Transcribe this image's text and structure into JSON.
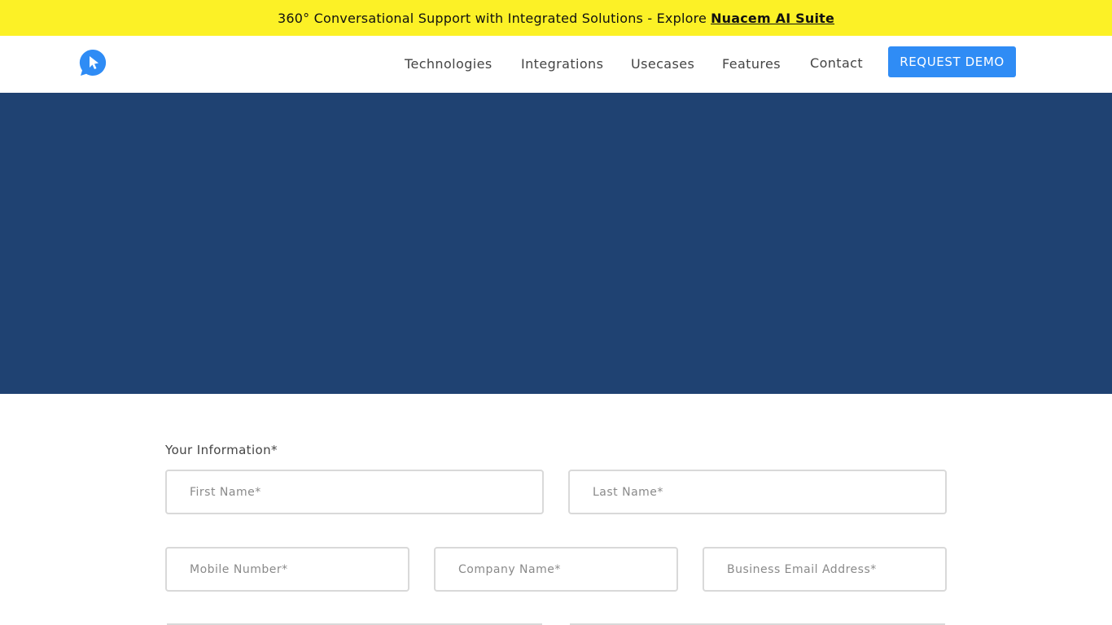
{
  "announcement": {
    "text": "360° Conversational Support with Integrated Solutions - Explore",
    "link": "Nuacem AI Suite"
  },
  "nav": {
    "logo_icon": "chat-bubble-logo-icon",
    "items": [
      {
        "label": "Technologies"
      },
      {
        "label": "Integrations"
      },
      {
        "label": "Usecases"
      },
      {
        "label": "Features"
      },
      {
        "label": "Contact"
      }
    ],
    "cta": "REQUEST DEMO"
  },
  "colors": {
    "announcement_bg": "#fcf126",
    "accent": "#2f8cf5",
    "hero_bg": "#1f4272"
  },
  "form": {
    "section_label": "Your Information*",
    "first_name": {
      "placeholder": "First Name*",
      "value": ""
    },
    "last_name": {
      "placeholder": "Last Name*",
      "value": ""
    },
    "mobile": {
      "placeholder": "Mobile Number*",
      "value": ""
    },
    "company": {
      "placeholder": "Company Name*",
      "value": ""
    },
    "email": {
      "placeholder": "Business Email Address*",
      "value": ""
    }
  }
}
